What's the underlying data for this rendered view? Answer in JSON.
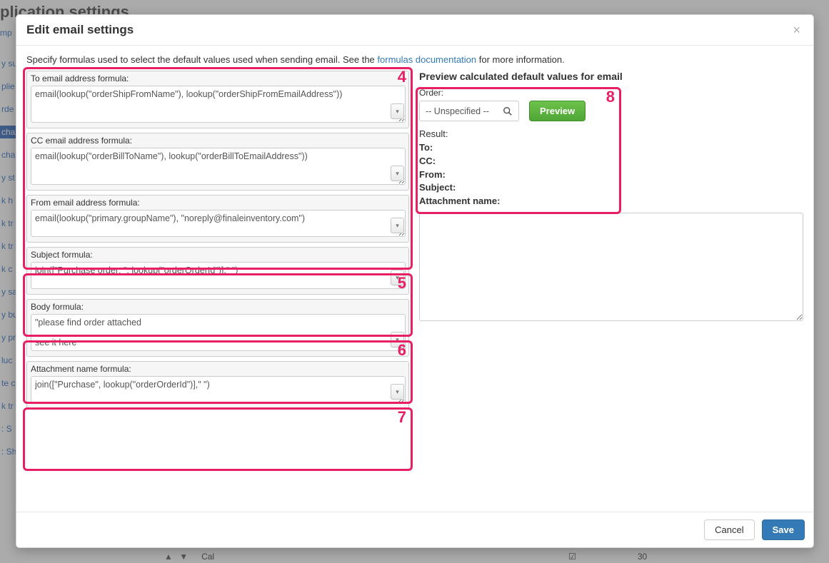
{
  "background": {
    "page_title": "plication settings",
    "tab_link": "mp",
    "side_items": [
      "y su",
      "plie",
      "rde",
      "cha",
      "cha",
      "y st",
      "k h",
      "k tr",
      "k tr",
      "k c",
      "y sa",
      "y bu",
      "y pr",
      "luc",
      "te c",
      "k tr",
      ": S",
      ": Shipping"
    ],
    "side_selected_index": 3,
    "bottom": {
      "arrows": "▲  ▼",
      "label": "Cal",
      "value": "30"
    }
  },
  "modal": {
    "title": "Edit email settings",
    "intro_prefix": "Specify formulas used to select the default values used when sending email. See the ",
    "intro_link": "formulas documentation",
    "intro_suffix": " for more information.",
    "close_glyph": "×",
    "dropdown_glyph": "▾"
  },
  "formulas": {
    "to": {
      "label": "To email address formula:",
      "value": "email(lookup(\"orderShipFromName\"), lookup(\"orderShipFromEmailAddress\"))",
      "rows": 3
    },
    "cc": {
      "label": "CC email address formula:",
      "value": "email(lookup(\"orderBillToName\"), lookup(\"orderBillToEmailAddress\"))",
      "rows": 3
    },
    "from": {
      "label": "From email address formula:",
      "value": "email(lookup(\"primary.groupName\"), \"noreply@finaleinventory.com\")",
      "rows": 2
    },
    "subject": {
      "label": "Subject formula:",
      "value": "join([\"Purchase order: \", lookup(\"orderOrderId\")],\" \")",
      "rows": 2
    },
    "body": {
      "label": "Body formula:",
      "value": "\"please find order attached\n\nsee it here",
      "rows": 3
    },
    "attachment": {
      "label": "Attachment name formula:",
      "value": "join([\"Purchase\", lookup(\"orderOrderId\")],\" \")",
      "rows": 2
    }
  },
  "callouts": {
    "box4": "4",
    "box5": "5",
    "box6": "6",
    "box7": "7",
    "box8": "8"
  },
  "preview": {
    "title": "Preview calculated default values for email",
    "order_label": "Order:",
    "order_value": "-- Unspecified --",
    "preview_button": "Preview",
    "result_label": "Result:",
    "lines": {
      "to_label": "To:",
      "to_value": "",
      "cc_label": "CC:",
      "cc_value": "",
      "from_label": "From:",
      "from_value": "",
      "subject_label": "Subject:",
      "subject_value": "",
      "att_label": "Attachment name:",
      "att_value": ""
    },
    "body_textarea": ""
  },
  "footer": {
    "cancel": "Cancel",
    "save": "Save"
  }
}
